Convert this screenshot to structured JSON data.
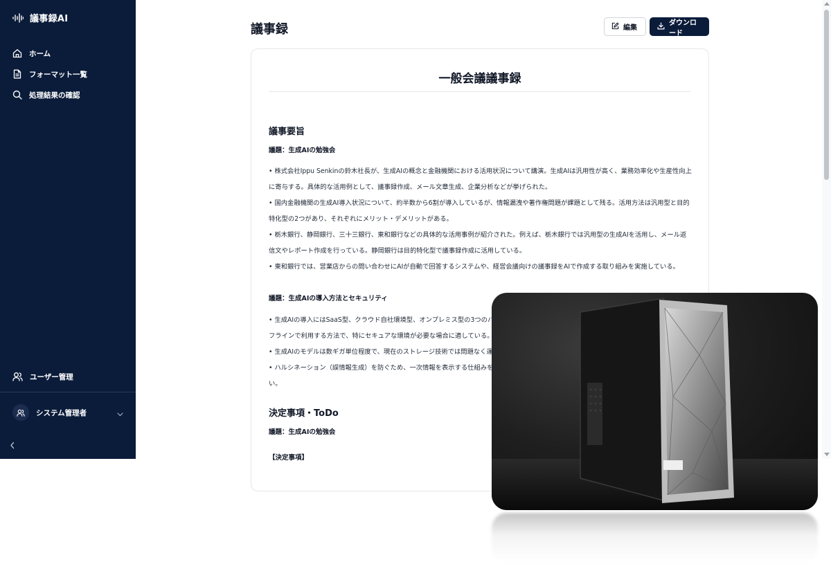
{
  "app": {
    "title": "議事録AI"
  },
  "sidebar": {
    "nav": [
      {
        "label": "ホーム",
        "icon": "home-icon"
      },
      {
        "label": "フォーマット一覧",
        "icon": "document-icon"
      },
      {
        "label": "処理結果の確認",
        "icon": "search-icon"
      }
    ],
    "user_management": {
      "label": "ユーザー管理",
      "icon": "users-icon"
    },
    "account": {
      "name": "システム管理者",
      "icon": "users-icon"
    },
    "collapse_icon": "chevron-left-icon"
  },
  "header": {
    "title": "議事録",
    "edit_label": "編集",
    "download_label": "ダウンロード"
  },
  "document": {
    "title": "一般会議議事録",
    "sections": [
      {
        "heading": "議事要旨",
        "topics": [
          {
            "title": "議題：生成AIの勉強会",
            "bullets": [
              "• 株式会社Ippu Senkinの鈴木社長が、生成AIの概念と金融機関における活用状況について講演。生成AIは汎用性が高く、業務効率化や生産性向上に寄与する。具体的な活用例として、議事録作成、メール文章生成、企業分析などが挙げられた。",
              "• 国内金融機関の生成AI導入状況について、約半数から6割が導入しているが、情報漏洩や著作権問題が課題として残る。活用方法は汎用型と目的特化型の2つがあり、それぞれにメリット・デメリットがある。",
              "• 栃木銀行、静岡銀行、三十三銀行、東和銀行などの具体的な活用事例が紹介された。例えば、栃木銀行では汎用型の生成AIを活用し、メール返信文やレポート作成を行っている。静岡銀行は目的特化型で議事録作成に活用している。",
              "• 東和銀行では、営業店からの問い合わせにAIが自動で回答するシステムや、経営会議向けの議事録をAIで作成する取り組みを実施している。"
            ]
          },
          {
            "title": "議題：生成AIの導入方法とセキュリティ",
            "bullets": [
              "• 生成AIの導入にはSaaS型、クラウド自社環境型、オンプレミス型の3つのパタ",
              "フラインで利用する方法で、特にセキュアな環境が必要な場合に適している。",
              "• 生成AIのモデルは数ギガ単位程度で、現在のストレージ技術では問題なく運",
              "• ハルシネーション（誤情報生成）を防ぐため、一次情報を表示する仕組みを",
              "い。"
            ]
          }
        ]
      },
      {
        "heading": "決定事項・ToDo",
        "topics": [
          {
            "title": "議題：生成AIの勉強会",
            "subheading": "【決定事項】"
          }
        ]
      }
    ]
  },
  "colors": {
    "sidebar_bg": "#0b1c3a",
    "primary_button": "#0b1c3a",
    "text": "#111827",
    "border": "#e5e7eb"
  }
}
